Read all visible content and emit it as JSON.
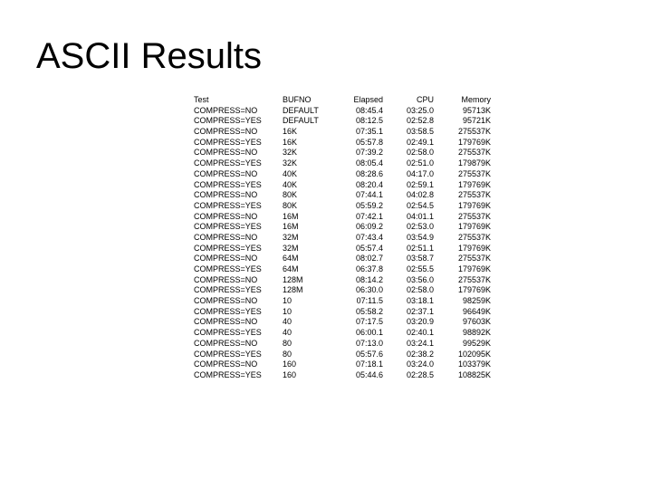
{
  "title": "ASCII Results",
  "headers": {
    "test": "Test",
    "bufno": "BUFNO",
    "elapsed": "Elapsed",
    "cpu": "CPU",
    "memory": "Memory"
  },
  "rows": [
    {
      "test": "COMPRESS=NO",
      "bufno": "DEFAULT",
      "elapsed": "08:45.4",
      "cpu": "03:25.0",
      "memory": "95713K"
    },
    {
      "test": "COMPRESS=YES",
      "bufno": "DEFAULT",
      "elapsed": "08:12.5",
      "cpu": "02:52.8",
      "memory": "95721K"
    },
    {
      "test": "COMPRESS=NO",
      "bufno": "16K",
      "elapsed": "07:35.1",
      "cpu": "03:58.5",
      "memory": "275537K"
    },
    {
      "test": "COMPRESS=YES",
      "bufno": "16K",
      "elapsed": "05:57.8",
      "cpu": "02:49.1",
      "memory": "179769K"
    },
    {
      "test": "COMPRESS=NO",
      "bufno": "32K",
      "elapsed": "07:39.2",
      "cpu": "02:58.0",
      "memory": "275537K"
    },
    {
      "test": "COMPRESS=YES",
      "bufno": "32K",
      "elapsed": "08:05.4",
      "cpu": "02:51.0",
      "memory": "179879K"
    },
    {
      "test": "COMPRESS=NO",
      "bufno": "40K",
      "elapsed": "08:28.6",
      "cpu": "04:17.0",
      "memory": "275537K"
    },
    {
      "test": "COMPRESS=YES",
      "bufno": "40K",
      "elapsed": "08:20.4",
      "cpu": "02:59.1",
      "memory": "179769K"
    },
    {
      "test": "COMPRESS=NO",
      "bufno": "80K",
      "elapsed": "07:44.1",
      "cpu": "04:02.8",
      "memory": "275537K"
    },
    {
      "test": "COMPRESS=YES",
      "bufno": "80K",
      "elapsed": "05:59.2",
      "cpu": "02:54.5",
      "memory": "179769K"
    },
    {
      "test": "COMPRESS=NO",
      "bufno": "16M",
      "elapsed": "07:42.1",
      "cpu": "04:01.1",
      "memory": "275537K"
    },
    {
      "test": "COMPRESS=YES",
      "bufno": "16M",
      "elapsed": "06:09.2",
      "cpu": "02:53.0",
      "memory": "179769K"
    },
    {
      "test": "COMPRESS=NO",
      "bufno": "32M",
      "elapsed": "07:43.4",
      "cpu": "03:54.9",
      "memory": "275537K"
    },
    {
      "test": "COMPRESS=YES",
      "bufno": "32M",
      "elapsed": "05:57.4",
      "cpu": "02:51.1",
      "memory": "179769K"
    },
    {
      "test": "COMPRESS=NO",
      "bufno": "64M",
      "elapsed": "08:02.7",
      "cpu": "03:58.7",
      "memory": "275537K"
    },
    {
      "test": "COMPRESS=YES",
      "bufno": "64M",
      "elapsed": "06:37.8",
      "cpu": "02:55.5",
      "memory": "179769K"
    },
    {
      "test": "COMPRESS=NO",
      "bufno": "128M",
      "elapsed": "08:14.2",
      "cpu": "03:56.0",
      "memory": "275537K"
    },
    {
      "test": "COMPRESS=YES",
      "bufno": "128M",
      "elapsed": "06:30.0",
      "cpu": "02:58.0",
      "memory": "179769K"
    },
    {
      "test": "COMPRESS=NO",
      "bufno": "10",
      "elapsed": "07:11.5",
      "cpu": "03:18.1",
      "memory": "98259K"
    },
    {
      "test": "COMPRESS=YES",
      "bufno": "10",
      "elapsed": "05:58.2",
      "cpu": "02:37.1",
      "memory": "96649K"
    },
    {
      "test": "COMPRESS=NO",
      "bufno": "40",
      "elapsed": "07:17.5",
      "cpu": "03:20.9",
      "memory": "97603K"
    },
    {
      "test": "COMPRESS=YES",
      "bufno": "40",
      "elapsed": "06:00.1",
      "cpu": "02:40.1",
      "memory": "98892K"
    },
    {
      "test": "COMPRESS=NO",
      "bufno": "80",
      "elapsed": "07:13.0",
      "cpu": "03:24.1",
      "memory": "99529K"
    },
    {
      "test": "COMPRESS=YES",
      "bufno": "80",
      "elapsed": "05:57.6",
      "cpu": "02:38.2",
      "memory": "102095K"
    },
    {
      "test": "COMPRESS=NO",
      "bufno": "160",
      "elapsed": "07:18.1",
      "cpu": "03:24.0",
      "memory": "103379K"
    },
    {
      "test": "COMPRESS=YES",
      "bufno": "160",
      "elapsed": "05:44.6",
      "cpu": "02:28.5",
      "memory": "108825K"
    }
  ]
}
